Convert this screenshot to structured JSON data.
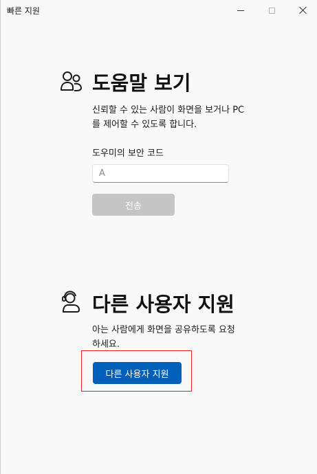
{
  "window": {
    "title": "빠른 지원"
  },
  "get_help": {
    "icon": "people-icon",
    "heading": "도움말 보기",
    "description_line1": "신뢰할 수 있는 사람이 화면을 보거나 PC",
    "description_line2": "를 제어할 수 있도록 합니다.",
    "code_label": "도우미의 보안 코드",
    "code_placeholder": "A",
    "code_value": "",
    "submit_label": "전송"
  },
  "give_help": {
    "icon": "person-headset-icon",
    "heading": "다른 사용자 지원",
    "description_line1": "아는 사람에게 화면을 공유하도록 요청",
    "description_line2": "하세요.",
    "button_label": "다른 사용자 지원"
  },
  "colors": {
    "accent": "#005fb8",
    "disabled_button": "#c5c5c5",
    "highlight": "#e02020",
    "background": "#f9f9f9"
  }
}
